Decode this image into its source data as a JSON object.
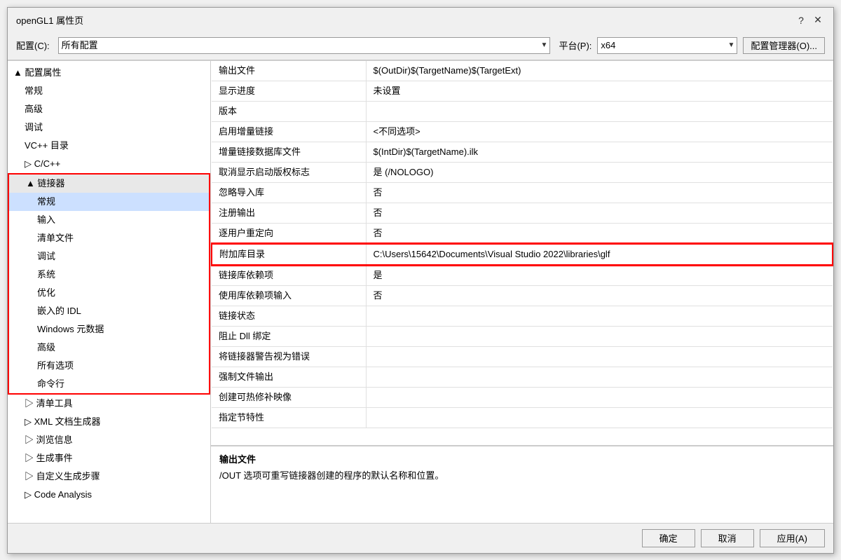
{
  "window": {
    "title": "openGL1 属性页",
    "help_btn": "?",
    "close_btn": "✕"
  },
  "config_row": {
    "config_label": "配置(C):",
    "config_value": "所有配置",
    "platform_label": "平台(P):",
    "platform_value": "x64",
    "manager_btn": "配置管理器(O)..."
  },
  "tree": {
    "items": [
      {
        "label": "▲ 配置属性",
        "level": "parent",
        "expanded": true
      },
      {
        "label": "常规",
        "level": "level1"
      },
      {
        "label": "高级",
        "level": "level1"
      },
      {
        "label": "调试",
        "level": "level1"
      },
      {
        "label": "VC++ 目录",
        "level": "level1"
      },
      {
        "label": "▷ C/C++",
        "level": "level1"
      },
      {
        "label": "▲ 链接器",
        "level": "level1",
        "highlighted": true
      },
      {
        "label": "常规",
        "level": "level2",
        "selected": true
      },
      {
        "label": "输入",
        "level": "level2"
      },
      {
        "label": "清单文件",
        "level": "level2"
      },
      {
        "label": "调试",
        "level": "level2"
      },
      {
        "label": "系统",
        "level": "level2"
      },
      {
        "label": "优化",
        "level": "level2"
      },
      {
        "label": "嵌入的 IDL",
        "level": "level2"
      },
      {
        "label": "Windows 元数据",
        "level": "level2"
      },
      {
        "label": "高级",
        "level": "level2"
      },
      {
        "label": "所有选项",
        "level": "level2"
      },
      {
        "label": "命令行",
        "level": "level2"
      },
      {
        "label": "▷ 清单工具",
        "level": "level1"
      },
      {
        "label": "▷ XML 文档生成器",
        "level": "level1"
      },
      {
        "label": "▷ 浏览信息",
        "level": "level1"
      },
      {
        "label": "▷ 生成事件",
        "level": "level1"
      },
      {
        "label": "▷ 自定义生成步骤",
        "level": "level1"
      },
      {
        "label": "▷ Code Analysis",
        "level": "level1"
      }
    ]
  },
  "properties": {
    "rows": [
      {
        "name": "输出文件",
        "value": "$(OutDir)$(TargetName)$(TargetExt)"
      },
      {
        "name": "显示进度",
        "value": "未设置"
      },
      {
        "name": "版本",
        "value": ""
      },
      {
        "name": "启用增量链接",
        "value": "<不同选项>"
      },
      {
        "name": "增量链接数据库文件",
        "value": "$(IntDir)$(TargetName).ilk"
      },
      {
        "name": "取消显示启动版权标志",
        "value": "是 (/NOLOGO)"
      },
      {
        "name": "忽略导入库",
        "value": "否"
      },
      {
        "name": "注册输出",
        "value": "否"
      },
      {
        "name": "逐用户重定向",
        "value": "否"
      },
      {
        "name": "附加库目录",
        "value": "C:\\Users\\15642\\Documents\\Visual Studio 2022\\libraries\\glf",
        "highlighted": true
      },
      {
        "name": "链接库依赖项",
        "value": "是"
      },
      {
        "name": "使用库依赖项输入",
        "value": "否"
      },
      {
        "name": "链接状态",
        "value": ""
      },
      {
        "name": "阻止 Dll 绑定",
        "value": ""
      },
      {
        "name": "将链接器警告视为错误",
        "value": ""
      },
      {
        "name": "强制文件输出",
        "value": ""
      },
      {
        "name": "创建可热修补映像",
        "value": ""
      },
      {
        "name": "指定节特性",
        "value": ""
      }
    ]
  },
  "description": {
    "title": "输出文件",
    "text": "/OUT 选项可重写链接器创建的程序的默认名称和位置。"
  },
  "buttons": {
    "ok": "确定",
    "cancel": "取消",
    "apply": "应用(A)"
  }
}
